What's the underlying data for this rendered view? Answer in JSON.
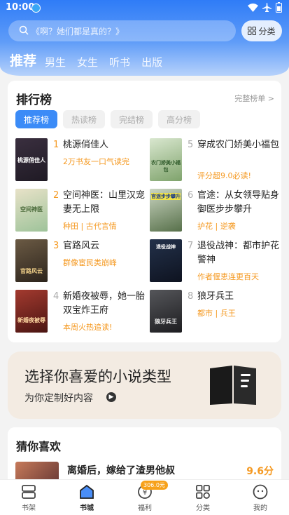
{
  "status_bar": {
    "time": "10:00"
  },
  "search": {
    "placeholder": "《啊？她们都是真的？》",
    "category_label": "分类"
  },
  "tabs": [
    {
      "label": "推荐",
      "active": true
    },
    {
      "label": "男生"
    },
    {
      "label": "女生"
    },
    {
      "label": "听书"
    },
    {
      "label": "出版"
    }
  ],
  "ranking": {
    "title": "排行榜",
    "more_label": "完整榜单 >",
    "chips": [
      "推荐榜",
      "热读榜",
      "完结榜",
      "高分榜"
    ],
    "books": [
      {
        "rank": "1",
        "name": "桃源俏佳人",
        "tag": "2万书友一口气读完"
      },
      {
        "rank": "2",
        "name": "空间神医：山里汉宠妻无上限",
        "tag": "种田 | 古代言情"
      },
      {
        "rank": "3",
        "name": "官路风云",
        "tag": "群像宦民类崩峰"
      },
      {
        "rank": "4",
        "name": "新婚夜被辱，她一胎双宝炸王府",
        "tag": "本周火热追读!"
      },
      {
        "rank": "5",
        "name": "穿成农门娇美小福包",
        "tag": "评分超9.0必读!"
      },
      {
        "rank": "6",
        "name": "官途：从女领导贴身御医步步攀升",
        "tag": "护花 | 逆袭"
      },
      {
        "rank": "7",
        "name": "退役战神：都市护花警神",
        "tag": "作者偃恵连更百天"
      },
      {
        "rank": "8",
        "name": "狼牙兵王",
        "tag": "都市 | 兵王"
      }
    ],
    "cover_texts": [
      "桃源俏佳人",
      "空间神医",
      "官路风云",
      "新婚夜被辱",
      "农门娇美小福包",
      "官途步步攀升",
      "退役战神",
      "狼牙兵王"
    ]
  },
  "banner": {
    "title": "选择你喜爱的小说类型",
    "subtitle": "为你定制好内容"
  },
  "guess": {
    "title": "猜你喜欢",
    "book_name": "离婚后，嫁给了渣男他叔",
    "score": "9.6分"
  },
  "bottom_nav": {
    "items": [
      {
        "label": "书架"
      },
      {
        "label": "书城",
        "active": true
      },
      {
        "label": "福利"
      },
      {
        "label": "分类"
      },
      {
        "label": "我的"
      }
    ],
    "badge": "306.0元"
  },
  "colors": {
    "accent": "#3b8bf7",
    "orange": "#f59a23"
  }
}
